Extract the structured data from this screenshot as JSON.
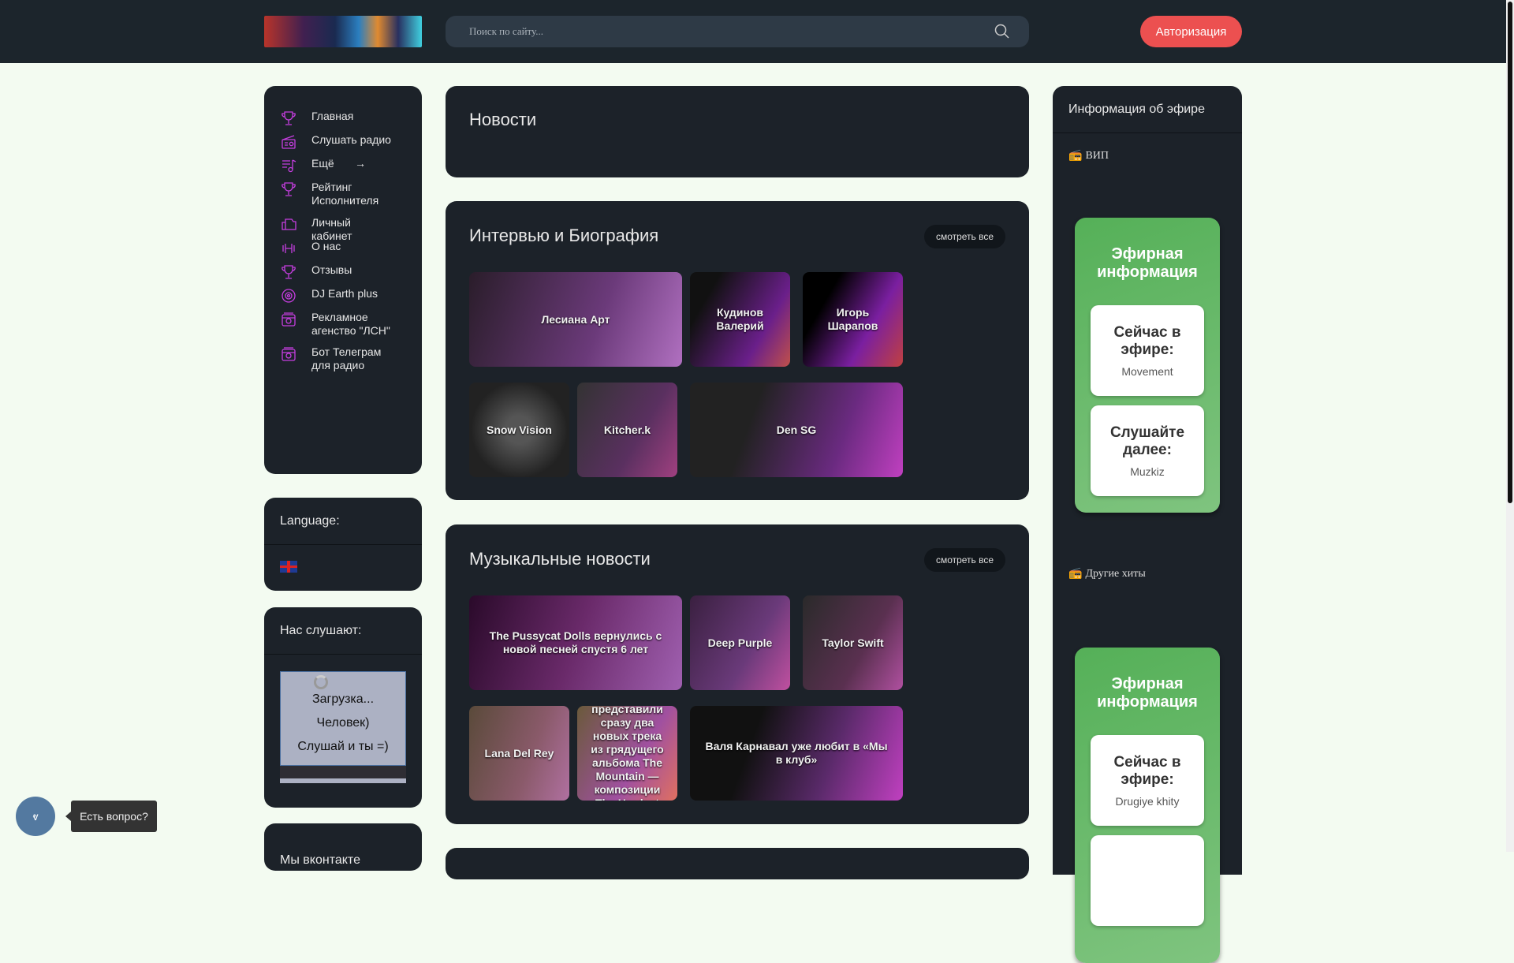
{
  "header": {
    "search_placeholder": "Поиск по сайту...",
    "auth_label": "Авторизация"
  },
  "colors": {
    "accent": "#ec5050",
    "icon": "#c63ee0",
    "header": "#1c252c",
    "card": "#1c2229",
    "green": "#55b058"
  },
  "menu": [
    {
      "label": "Главная",
      "icon": "trophy-icon"
    },
    {
      "label": "Слушать радио",
      "icon": "radio-icon"
    },
    {
      "label": "Ещё",
      "icon": "playlist-icon"
    },
    {
      "label": "Рейтинг Исполнителя",
      "icon": "trophy-icon"
    },
    {
      "label": "Личный кабинет",
      "icon": "folder-icon"
    },
    {
      "label": "О нас",
      "icon": "dumbbell-icon"
    },
    {
      "label": "Отзывы",
      "icon": "trophy-icon"
    },
    {
      "label": "DJ Earth plus",
      "icon": "disc-icon"
    },
    {
      "label": "Рекламное агенство \"ЛСН\"",
      "icon": "camera-icon"
    },
    {
      "label": "Бот Телеграм для радио",
      "icon": "camera-icon"
    }
  ],
  "language": {
    "title": "Language:"
  },
  "listeners": {
    "title": "Нас слушают:",
    "loading": "Загрузка...",
    "people": "Человек)",
    "cta": "Слушай и ты =)"
  },
  "vk": {
    "title": "Мы вконтакте"
  },
  "news": {
    "title": "Новости"
  },
  "interviews": {
    "title": "Интервью и Биография",
    "see_all": "смотреть все",
    "tiles": [
      "Лесиана Арт",
      "Кудинов Валерий",
      "Игорь Шарапов",
      "Snow Vision",
      "Kitcher.k",
      "Den SG"
    ]
  },
  "music": {
    "title": "Музыкальные новости",
    "see_all": "смотреть все",
    "tiles": [
      "The Pussycat Dolls вернулись с новой песней спустя 6 лет",
      "Deep Purple",
      "Taylor Swift",
      "Lana Del Rey",
      "представили сразу два новых трека из грядущего альбома The Mountain — композиции The Hardest Thing и",
      "Валя Карнавал уже любит в «Мы в клуб»"
    ]
  },
  "air": {
    "title": "Информация об эфире",
    "vip": "ВИП",
    "other": "Другие хиты",
    "block1": {
      "title": "Эфирная информация",
      "now_label": "Сейчас в эфире:",
      "now": "Movement",
      "next_label": "Слушайте далее:",
      "next": "Muzkiz"
    },
    "block2": {
      "title": "Эфирная информация",
      "now_label": "Сейчас в эфире:",
      "now": "Drugiye khity"
    }
  },
  "chat": {
    "label": "Есть вопрос?"
  }
}
